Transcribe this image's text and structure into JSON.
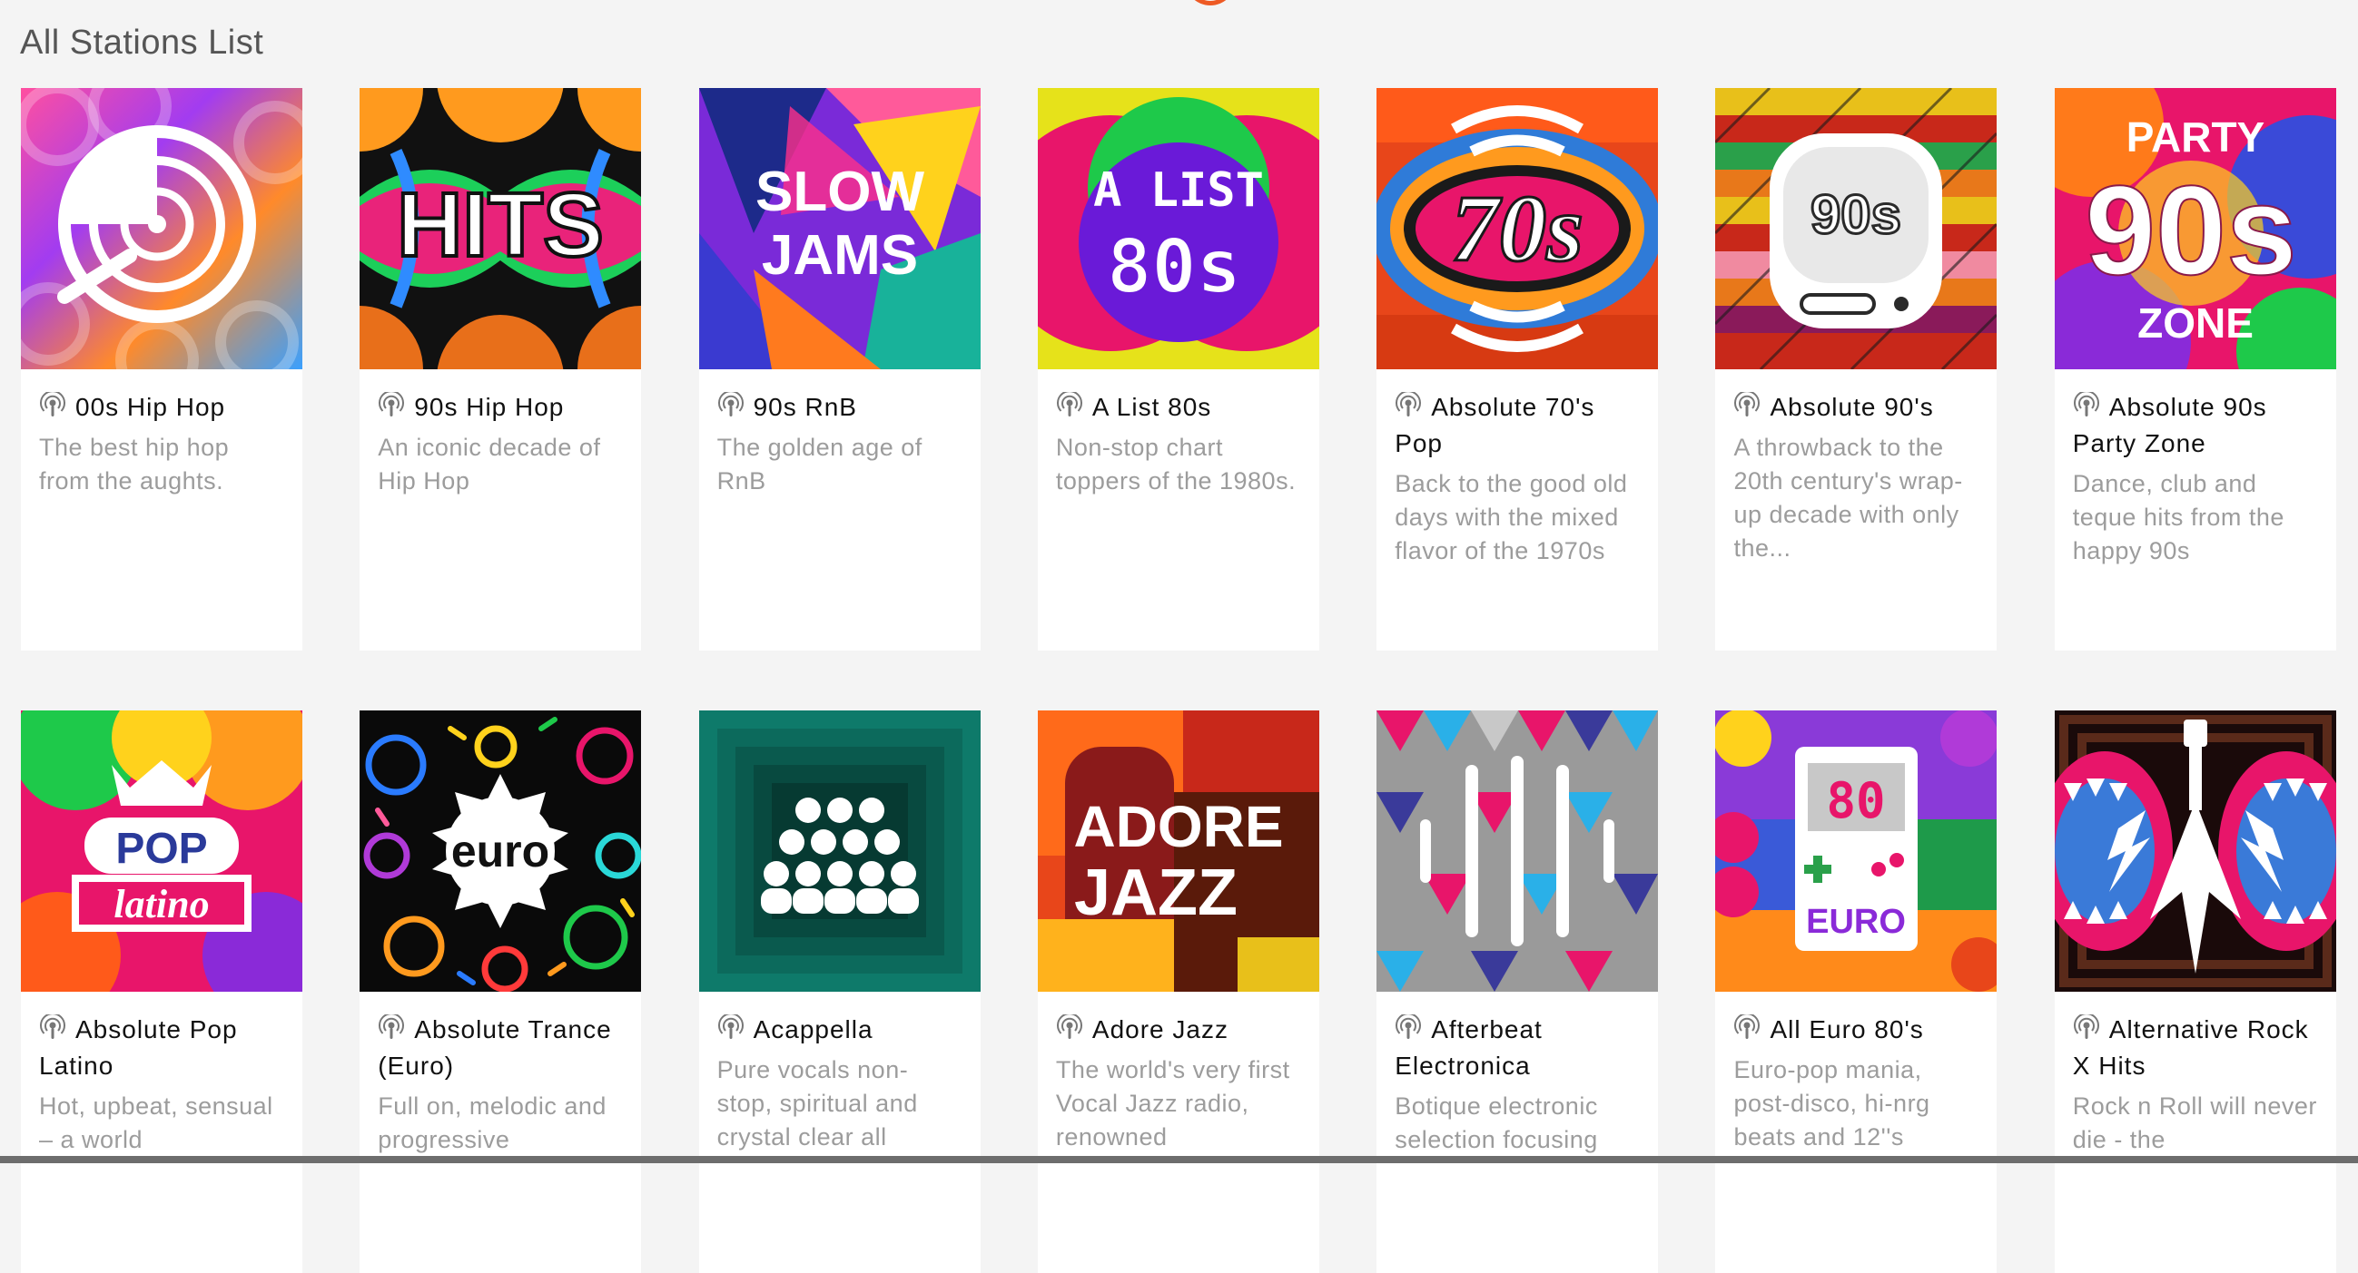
{
  "page": {
    "section_title": "All Stations List"
  },
  "stations": [
    {
      "title": "00s Hip Hop",
      "desc": "The best hip hop from the aughts.",
      "art": "00s-hip-hop-art"
    },
    {
      "title": "90s Hip Hop",
      "desc": "An iconic decade of Hip Hop",
      "art": "hits-art",
      "art_text": "HITS"
    },
    {
      "title": "90s RnB",
      "desc": "The golden age of RnB",
      "art": "slow-jams-art",
      "art_text": [
        "SLOW",
        "JAMS"
      ]
    },
    {
      "title": "A List 80s",
      "desc": "Non-stop chart toppers of the 1980s.",
      "art": "a-list-80s-art",
      "art_text": [
        "A LIST",
        "80s"
      ]
    },
    {
      "title": "Absolute 70's Pop",
      "desc": "Back to the good old days with the mixed flavor of the 1970s",
      "art": "70s-art",
      "art_text": "70s"
    },
    {
      "title": "Absolute 90's",
      "desc": "A throwback to the 20th century's wrap-up decade with only the...",
      "art": "90s-radio-art",
      "art_text": "90s"
    },
    {
      "title": "Absolute 90s Party Zone",
      "desc": "Dance, club and teque hits from the happy 90s",
      "art": "party-90s-zone-art",
      "art_text": [
        "PARTY",
        "90s",
        "ZONE"
      ]
    },
    {
      "title": "Absolute Pop Latino",
      "desc": "Hot, upbeat, sensual – a world",
      "art": "pop-latino-art",
      "art_text": [
        "POP",
        "latino"
      ]
    },
    {
      "title": "Absolute Trance (Euro)",
      "desc": "Full on, melodic and progressive",
      "art": "euro-art",
      "art_text": "euro"
    },
    {
      "title": "Acappella",
      "desc": "Pure vocals non-stop, spiritual and crystal clear all",
      "art": "acappella-art"
    },
    {
      "title": "Adore Jazz",
      "desc": "The world's very first Vocal Jazz radio, renowned",
      "art": "adore-jazz-art",
      "art_text": [
        "ADORE",
        "JAZZ"
      ]
    },
    {
      "title": "Afterbeat Electronica",
      "desc": "Botique electronic selection focusing",
      "art": "afterbeat-art"
    },
    {
      "title": "All Euro 80's",
      "desc": "Euro-pop mania, post-disco, hi-nrg beats and 12''s",
      "art": "euro-80s-art",
      "art_text": [
        "80",
        "EURO"
      ]
    },
    {
      "title": "Alternative Rock X Hits",
      "desc": "Rock n Roll will never die - the",
      "art": "rock-x-hits-art"
    }
  ],
  "colors": {
    "accent": "#ee5a24",
    "title_text": "#111111",
    "desc_text": "#9c9c9c",
    "page_bg": "#f4f4f4"
  },
  "icons": {
    "station": "podcast-icon"
  }
}
